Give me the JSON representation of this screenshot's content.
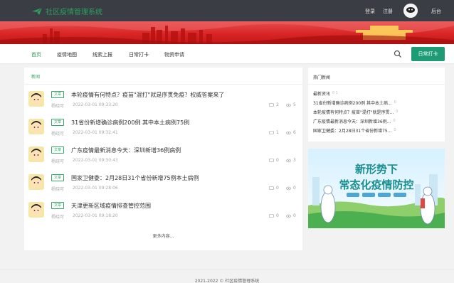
{
  "header": {
    "title": "社区疫情管理系统",
    "login": "登录",
    "register": "注册",
    "admin": "后台"
  },
  "nav": {
    "items": [
      "首页",
      "疫情地图",
      "线索上报",
      "日常打卡",
      "物资申请"
    ],
    "daily_button": "日常打卡"
  },
  "news": {
    "section_title": "新闻",
    "items": [
      {
        "tag": "文章",
        "title": "本轮疫情有何特点？疫苗\"混打\"就是序贯免疫？权威答案来了",
        "author": "杨晓可",
        "date": "2022-03-01 09:33:20",
        "comments": "2",
        "views": "5"
      },
      {
        "tag": "文章",
        "title": "31省份新增确诊病例200例 其中本土病例75例",
        "author": "杨晓可",
        "date": "2022-03-01 09:32:41",
        "comments": "1",
        "views": "6"
      },
      {
        "tag": "文章",
        "title": "广东疫情最新消息今天：深圳新增36例病例",
        "author": "杨晓可",
        "date": "2022-03-01 09:30:43",
        "comments": "0",
        "views": "3"
      },
      {
        "tag": "文章",
        "title": "国家卫健委：2月28日31个省份新增75例本土病例",
        "author": "杨晓可",
        "date": "2022-03-01 09:28:06",
        "comments": "0",
        "views": "0"
      },
      {
        "tag": "文章",
        "title": "天津更新区域疫情排查管控范围",
        "author": "杨晓可",
        "date": "2022-03-01 09:18:20",
        "comments": "0",
        "views": "0"
      }
    ],
    "more": "更多内容..."
  },
  "sidebar": {
    "title": "热门新闻",
    "items": [
      {
        "text": "最新资讯",
        "meta": "0 1"
      },
      {
        "text": "31省份新增确诊病例200例 其中本土病...",
        "meta": "0"
      },
      {
        "text": "本轮疫情有何特点？疫苗\"混打\"就是序贯...",
        "meta": "0"
      },
      {
        "text": "广东疫情最新消息今天：深圳新增36例...",
        "meta": "0"
      },
      {
        "text": "国家卫健委：2月28日31个省份新增75...",
        "meta": "0"
      }
    ],
    "poster_line1": "新形势下",
    "poster_line2": "常态化疫情防控"
  },
  "footer": {
    "text": "2021-2022 © 社区疫情管理系统"
  },
  "colors": {
    "topbar": "#3a3d44",
    "brand_green": "#2e9e5d",
    "button_green": "#1e9b74",
    "banner_red": "#d92525"
  }
}
